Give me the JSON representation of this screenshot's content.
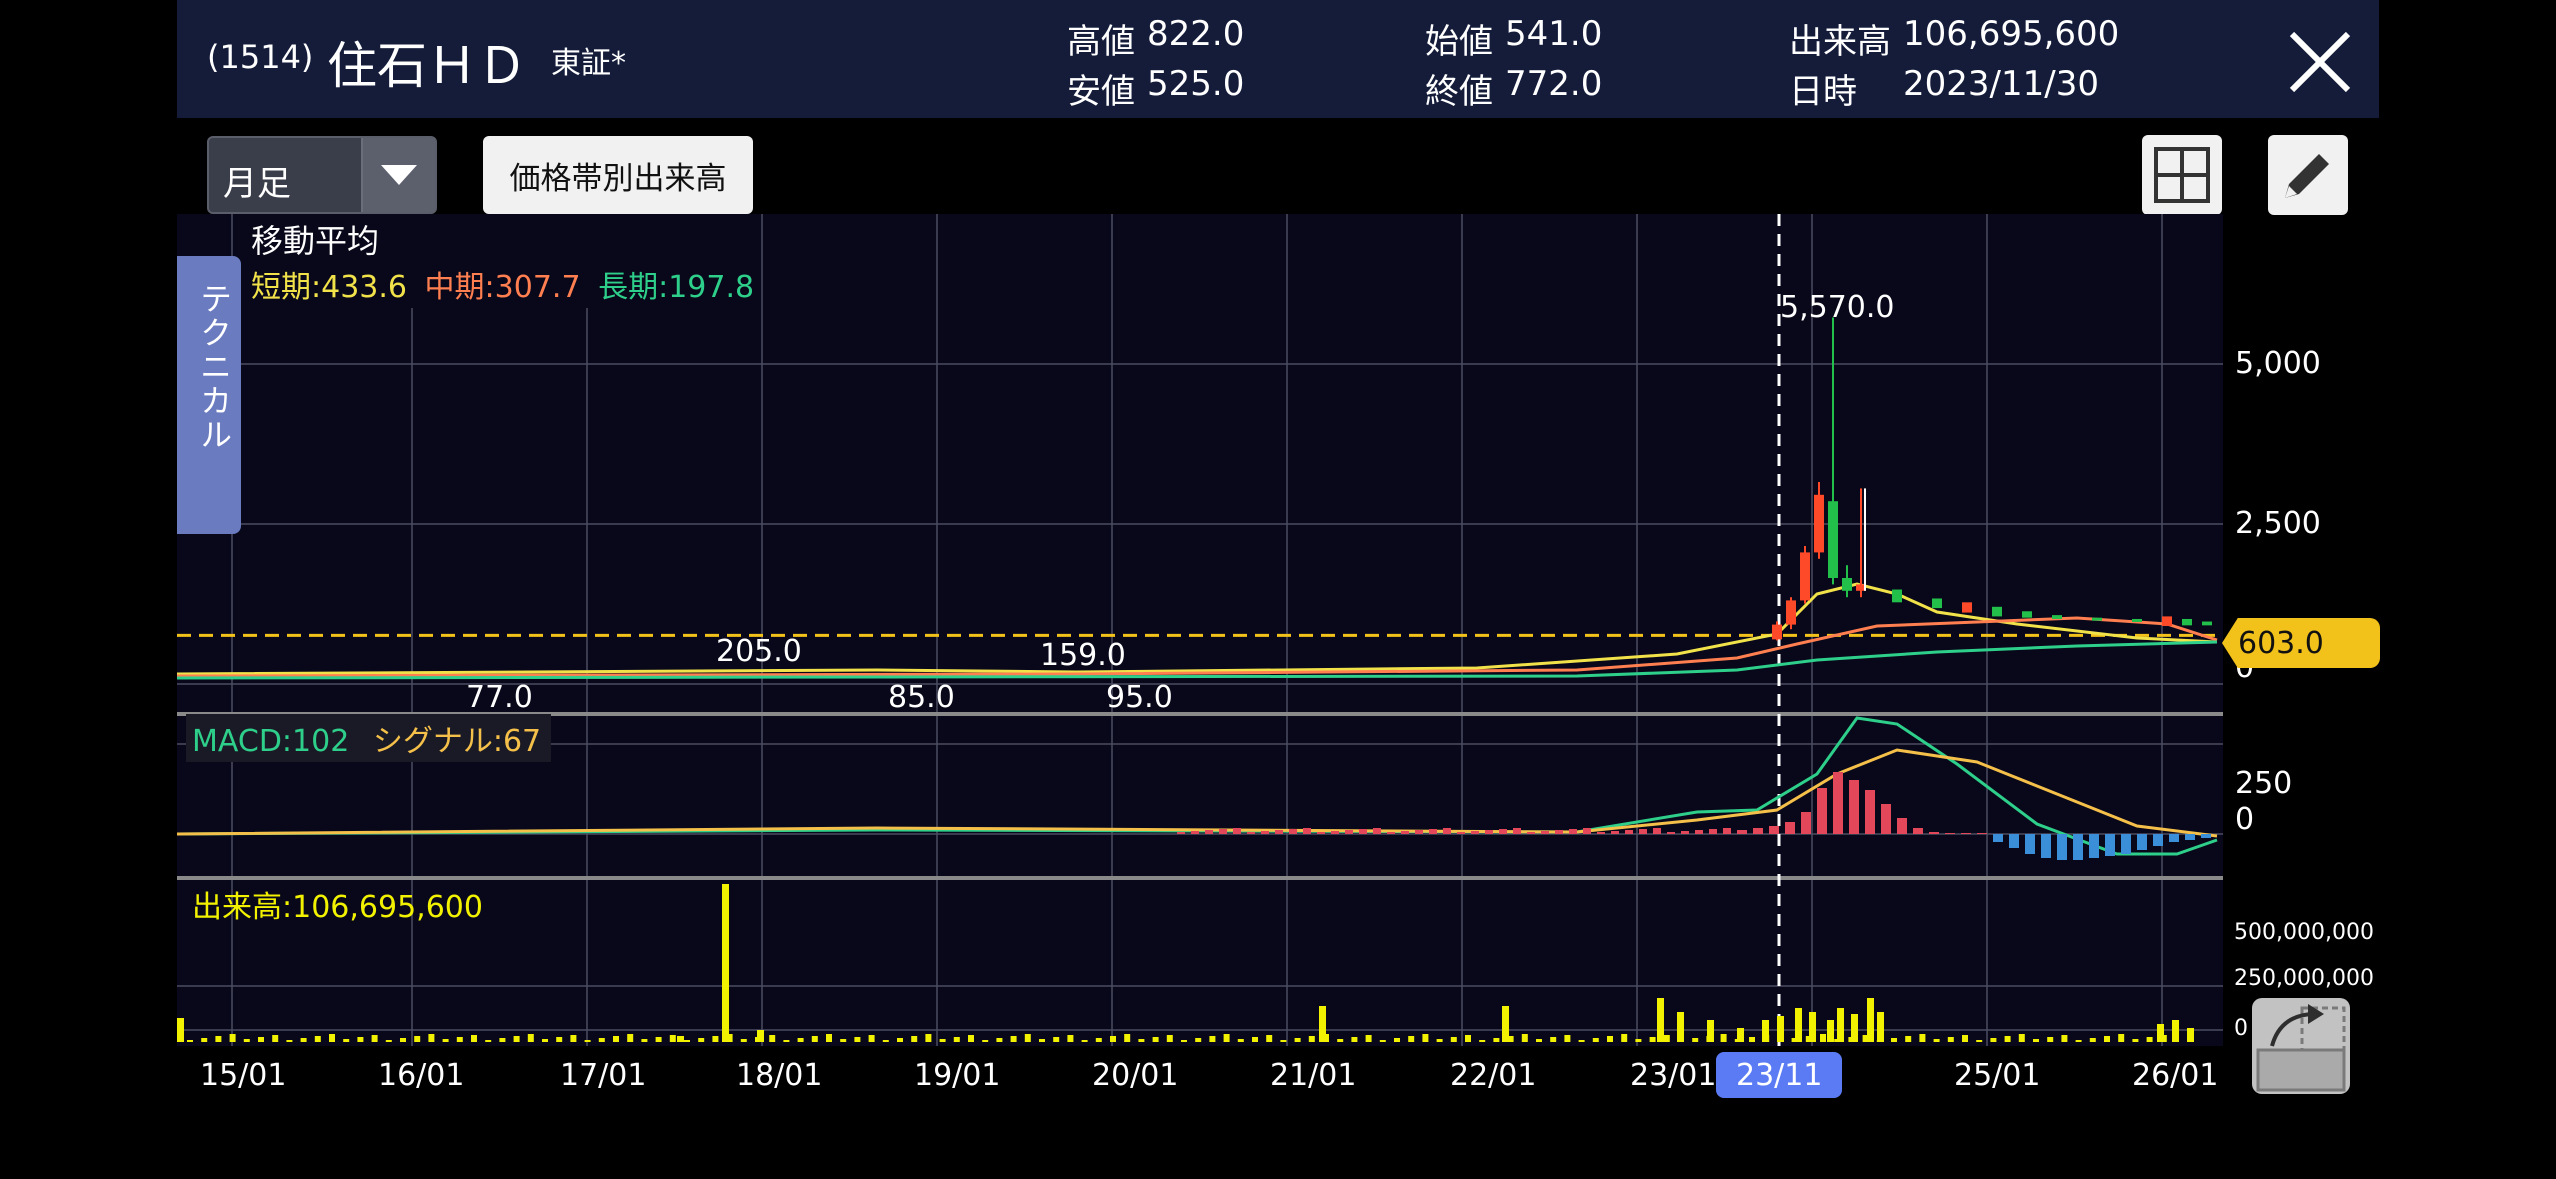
{
  "header": {
    "code": "(1514)",
    "name": "住石ＨＤ",
    "market": "東証*",
    "high_label": "高値",
    "high_value": "822.0",
    "low_label": "安値",
    "low_value": "525.0",
    "open_label": "始値",
    "open_value": "541.0",
    "close_label": "終値",
    "close_value": "772.0",
    "volume_label": "出来高",
    "volume_value": "106,695,600",
    "date_label": "日時",
    "date_value": "2023/11/30"
  },
  "toolbar": {
    "period_selected": "月足",
    "volume_by_price_label": "価格帯別出来高",
    "layout_icon": "grid-icon",
    "draw_icon": "pencil-icon"
  },
  "sidebar": {
    "technical_tab_label": "テクニカル"
  },
  "moving_average": {
    "title": "移動平均",
    "short_label": "短期:433.6",
    "mid_label": "中期:307.7",
    "long_label": "長期:197.8",
    "colors": {
      "short": "#f2e24a",
      "mid": "#ff7f50",
      "long": "#2ecf8a"
    }
  },
  "price_pane": {
    "axis_ticks": [
      "5,000",
      "2,500",
      "0"
    ],
    "current_price_badge": "603.0",
    "annotations": {
      "peak": "5,570.0",
      "a": "205.0",
      "b": "159.0",
      "c": "77.0",
      "d": "85.0",
      "e": "95.0"
    }
  },
  "macd_pane": {
    "macd_label": "MACD:102",
    "signal_label": "シグナル:67",
    "axis_ticks": [
      "250",
      "0"
    ],
    "colors": {
      "macd": "#2ecf8a",
      "signal": "#f5c04a",
      "hist_pos": "#e2485a",
      "hist_neg": "#3a8fd8"
    }
  },
  "volume_pane": {
    "label": "出来高:106,695,600",
    "axis_ticks": [
      "500,000,000",
      "250,000,000",
      "0"
    ],
    "color": "#f2f200"
  },
  "x_axis": {
    "ticks": [
      "15/01",
      "16/01",
      "17/01",
      "18/01",
      "19/01",
      "20/01",
      "21/01",
      "22/01",
      "23/01",
      "23/11",
      "25/01",
      "26/01"
    ],
    "highlight_label": "23/11"
  },
  "chart_data": {
    "type": "candlestick",
    "title": "",
    "x_ticks": [
      "15/01",
      "16/01",
      "17/01",
      "18/01",
      "19/01",
      "20/01",
      "21/01",
      "22/01",
      "23/01",
      "25/01",
      "26/01"
    ],
    "selected": "23/11",
    "price": {
      "ylim": [
        0,
        6000
      ],
      "labels": {
        "max": 5570.0,
        "current": 603.0
      },
      "candles_recent": [
        {
          "o": 541,
          "h": 822,
          "l": 525,
          "c": 772
        },
        {
          "o": 772,
          "h": 1200,
          "l": 700,
          "c": 1150
        },
        {
          "o": 1150,
          "h": 2000,
          "l": 1100,
          "c": 1900
        },
        {
          "o": 1900,
          "h": 3000,
          "l": 1800,
          "c": 2800
        },
        {
          "o": 2700,
          "h": 5570,
          "l": 1400,
          "c": 1500
        },
        {
          "o": 1500,
          "h": 1700,
          "l": 1200,
          "c": 1300
        },
        {
          "o": 1300,
          "h": 2900,
          "l": 1200,
          "c": 1400
        }
      ],
      "ma_short": [
        433.6
      ],
      "ma_mid": [
        307.7
      ],
      "ma_long": [
        197.8
      ]
    },
    "macd": {
      "macd": 102,
      "signal": 67
    },
    "volume": {
      "current": 106695600,
      "ylim": [
        0,
        600000000
      ]
    }
  }
}
